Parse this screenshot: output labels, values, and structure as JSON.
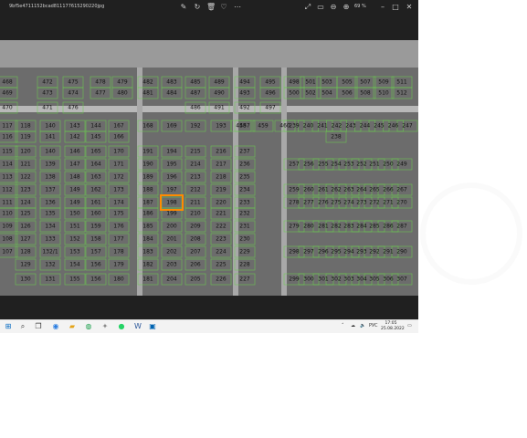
{
  "titlebar": {
    "filename": "9bf5e4711152bcad811177615290220jpg",
    "zoom": "69 %"
  },
  "map": {
    "highlighted_lot": "198",
    "highlight_color": "#ff8a00",
    "line_color": "#6bd04f",
    "lots": [
      {
        "n": "468",
        "c": 0,
        "r": 0
      },
      {
        "n": "472",
        "c": 1,
        "r": 0
      },
      {
        "n": "475",
        "c": 2,
        "r": 0
      },
      {
        "n": "478",
        "c": 3,
        "r": 0
      },
      {
        "n": "479",
        "c": 4,
        "r": 0
      },
      {
        "n": "482",
        "c": 5,
        "r": 0
      },
      {
        "n": "483",
        "c": 6,
        "r": 0
      },
      {
        "n": "485",
        "c": 7,
        "r": 0
      },
      {
        "n": "489",
        "c": 8,
        "r": 0
      },
      {
        "n": "494",
        "c": 9,
        "r": 0
      },
      {
        "n": "495",
        "c": 10,
        "r": 0
      },
      {
        "n": "498",
        "c": 11,
        "r": 0
      },
      {
        "n": "501",
        "c": 12,
        "r": 0
      },
      {
        "n": "503",
        "c": 13,
        "r": 0
      },
      {
        "n": "505",
        "c": 14,
        "r": 0
      },
      {
        "n": "507",
        "c": 15,
        "r": 0
      },
      {
        "n": "509",
        "c": 16,
        "r": 0
      },
      {
        "n": "511",
        "c": 17,
        "r": 0
      },
      {
        "n": "469",
        "c": 0,
        "r": 1
      },
      {
        "n": "473",
        "c": 1,
        "r": 1
      },
      {
        "n": "474",
        "c": 2,
        "r": 1
      },
      {
        "n": "477",
        "c": 3,
        "r": 1
      },
      {
        "n": "480",
        "c": 4,
        "r": 1
      },
      {
        "n": "481",
        "c": 5,
        "r": 1
      },
      {
        "n": "484",
        "c": 6,
        "r": 1
      },
      {
        "n": "487",
        "c": 7,
        "r": 1
      },
      {
        "n": "490",
        "c": 8,
        "r": 1
      },
      {
        "n": "493",
        "c": 9,
        "r": 1
      },
      {
        "n": "496",
        "c": 10,
        "r": 1
      },
      {
        "n": "500",
        "c": 11,
        "r": 1
      },
      {
        "n": "502",
        "c": 12,
        "r": 1
      },
      {
        "n": "504",
        "c": 13,
        "r": 1
      },
      {
        "n": "506",
        "c": 14,
        "r": 1
      },
      {
        "n": "508",
        "c": 15,
        "r": 1
      },
      {
        "n": "510",
        "c": 16,
        "r": 1
      },
      {
        "n": "512",
        "c": 17,
        "r": 1
      },
      {
        "n": "470",
        "c": 0,
        "r": 2
      },
      {
        "n": "471",
        "c": 1,
        "r": 2
      },
      {
        "n": "476",
        "c": 2,
        "r": 2
      },
      {
        "n": "486",
        "c": 7,
        "r": 2
      },
      {
        "n": "491",
        "c": 8,
        "r": 2
      },
      {
        "n": "492",
        "c": 9,
        "r": 2
      },
      {
        "n": "497",
        "c": 10,
        "r": 2
      },
      {
        "n": "117",
        "c": 0,
        "r": 3
      },
      {
        "n": "118",
        "c": 1,
        "r": 3
      },
      {
        "n": "140",
        "c": 2,
        "r": 3
      },
      {
        "n": "143",
        "c": 3,
        "r": 3
      },
      {
        "n": "144",
        "c": 4,
        "r": 3
      },
      {
        "n": "167",
        "c": 5,
        "r": 3
      },
      {
        "n": "168",
        "c": 6,
        "r": 3
      },
      {
        "n": "169",
        "c": 7,
        "r": 3
      },
      {
        "n": "192",
        "c": 8,
        "r": 3
      },
      {
        "n": "193",
        "c": 9,
        "r": 3
      },
      {
        "n": "457",
        "c": 10,
        "r": 3
      },
      {
        "n": "458",
        "c": 11,
        "r": 3
      },
      {
        "n": "459",
        "c": 12,
        "r": 3
      },
      {
        "n": "460",
        "c": 13,
        "r": 3
      },
      {
        "n": "239",
        "c": 14,
        "r": 3
      },
      {
        "n": "240",
        "c": 15,
        "r": 3
      },
      {
        "n": "241",
        "c": 16,
        "r": 3
      },
      {
        "n": "242",
        "c": 17,
        "r": 3
      },
      {
        "n": "243",
        "c": 18,
        "r": 3
      },
      {
        "n": "244",
        "c": 19,
        "r": 3
      },
      {
        "n": "245",
        "c": 20,
        "r": 3
      },
      {
        "n": "246",
        "c": 21,
        "r": 3
      },
      {
        "n": "247",
        "c": 22,
        "r": 3
      },
      {
        "n": "116",
        "c": 0,
        "r": 4
      },
      {
        "n": "119",
        "c": 1,
        "r": 4
      },
      {
        "n": "141",
        "c": 2,
        "r": 4
      },
      {
        "n": "142",
        "c": 3,
        "r": 4
      },
      {
        "n": "145",
        "c": 4,
        "r": 4
      },
      {
        "n": "166",
        "c": 5,
        "r": 4
      },
      {
        "n": "238",
        "c": 14,
        "r": 4
      },
      {
        "n": "115",
        "c": 0,
        "r": 5
      },
      {
        "n": "120",
        "c": 1,
        "r": 5
      },
      {
        "n": "140",
        "c": 2,
        "r": 5
      },
      {
        "n": "146",
        "c": 3,
        "r": 5
      },
      {
        "n": "165",
        "c": 4,
        "r": 5
      },
      {
        "n": "170",
        "c": 5,
        "r": 5
      },
      {
        "n": "191",
        "c": 6,
        "r": 5
      },
      {
        "n": "194",
        "c": 7,
        "r": 5
      },
      {
        "n": "215",
        "c": 8,
        "r": 5
      },
      {
        "n": "216",
        "c": 9,
        "r": 5
      },
      {
        "n": "237",
        "c": 10,
        "r": 5
      },
      {
        "n": "114",
        "c": 0,
        "r": 6
      },
      {
        "n": "121",
        "c": 1,
        "r": 6
      },
      {
        "n": "139",
        "c": 2,
        "r": 6
      },
      {
        "n": "147",
        "c": 3,
        "r": 6
      },
      {
        "n": "164",
        "c": 4,
        "r": 6
      },
      {
        "n": "171",
        "c": 5,
        "r": 6
      },
      {
        "n": "190",
        "c": 6,
        "r": 6
      },
      {
        "n": "195",
        "c": 7,
        "r": 6
      },
      {
        "n": "214",
        "c": 8,
        "r": 6
      },
      {
        "n": "217",
        "c": 9,
        "r": 6
      },
      {
        "n": "236",
        "c": 10,
        "r": 6
      },
      {
        "n": "257",
        "c": 11,
        "r": 6
      },
      {
        "n": "256",
        "c": 12,
        "r": 6
      },
      {
        "n": "255",
        "c": 13,
        "r": 6
      },
      {
        "n": "254",
        "c": 14,
        "r": 6
      },
      {
        "n": "253",
        "c": 15,
        "r": 6
      },
      {
        "n": "252",
        "c": 16,
        "r": 6
      },
      {
        "n": "251",
        "c": 17,
        "r": 6
      },
      {
        "n": "250",
        "c": 18,
        "r": 6
      },
      {
        "n": "249",
        "c": 19,
        "r": 6
      },
      {
        "n": "113",
        "c": 0,
        "r": 7
      },
      {
        "n": "122",
        "c": 1,
        "r": 7
      },
      {
        "n": "138",
        "c": 2,
        "r": 7
      },
      {
        "n": "148",
        "c": 3,
        "r": 7
      },
      {
        "n": "163",
        "c": 4,
        "r": 7
      },
      {
        "n": "172",
        "c": 5,
        "r": 7
      },
      {
        "n": "189",
        "c": 6,
        "r": 7
      },
      {
        "n": "196",
        "c": 7,
        "r": 7
      },
      {
        "n": "213",
        "c": 8,
        "r": 7
      },
      {
        "n": "218",
        "c": 9,
        "r": 7
      },
      {
        "n": "235",
        "c": 10,
        "r": 7
      },
      {
        "n": "112",
        "c": 0,
        "r": 8
      },
      {
        "n": "123",
        "c": 1,
        "r": 8
      },
      {
        "n": "137",
        "c": 2,
        "r": 8
      },
      {
        "n": "149",
        "c": 3,
        "r": 8
      },
      {
        "n": "162",
        "c": 4,
        "r": 8
      },
      {
        "n": "173",
        "c": 5,
        "r": 8
      },
      {
        "n": "188",
        "c": 6,
        "r": 8
      },
      {
        "n": "197",
        "c": 7,
        "r": 8
      },
      {
        "n": "212",
        "c": 8,
        "r": 8
      },
      {
        "n": "219",
        "c": 9,
        "r": 8
      },
      {
        "n": "234",
        "c": 10,
        "r": 8
      },
      {
        "n": "259",
        "c": 11,
        "r": 8
      },
      {
        "n": "260",
        "c": 12,
        "r": 8
      },
      {
        "n": "261",
        "c": 13,
        "r": 8
      },
      {
        "n": "262",
        "c": 14,
        "r": 8
      },
      {
        "n": "263",
        "c": 15,
        "r": 8
      },
      {
        "n": "264",
        "c": 16,
        "r": 8
      },
      {
        "n": "265",
        "c": 17,
        "r": 8
      },
      {
        "n": "266",
        "c": 18,
        "r": 8
      },
      {
        "n": "267",
        "c": 19,
        "r": 8
      },
      {
        "n": "111",
        "c": 0,
        "r": 9
      },
      {
        "n": "124",
        "c": 1,
        "r": 9
      },
      {
        "n": "136",
        "c": 2,
        "r": 9
      },
      {
        "n": "149",
        "c": 3,
        "r": 9
      },
      {
        "n": "161",
        "c": 4,
        "r": 9
      },
      {
        "n": "174",
        "c": 5,
        "r": 9
      },
      {
        "n": "187",
        "c": 6,
        "r": 9
      },
      {
        "n": "198",
        "c": 7,
        "r": 9
      },
      {
        "n": "211",
        "c": 8,
        "r": 9
      },
      {
        "n": "220",
        "c": 9,
        "r": 9
      },
      {
        "n": "233",
        "c": 10,
        "r": 9
      },
      {
        "n": "278",
        "c": 11,
        "r": 9
      },
      {
        "n": "277",
        "c": 12,
        "r": 9
      },
      {
        "n": "276",
        "c": 13,
        "r": 9
      },
      {
        "n": "275",
        "c": 14,
        "r": 9
      },
      {
        "n": "274",
        "c": 15,
        "r": 9
      },
      {
        "n": "273",
        "c": 16,
        "r": 9
      },
      {
        "n": "272",
        "c": 17,
        "r": 9
      },
      {
        "n": "271",
        "c": 18,
        "r": 9
      },
      {
        "n": "270",
        "c": 19,
        "r": 9
      },
      {
        "n": "110",
        "c": 0,
        "r": 10
      },
      {
        "n": "125",
        "c": 1,
        "r": 10
      },
      {
        "n": "135",
        "c": 2,
        "r": 10
      },
      {
        "n": "150",
        "c": 3,
        "r": 10
      },
      {
        "n": "160",
        "c": 4,
        "r": 10
      },
      {
        "n": "175",
        "c": 5,
        "r": 10
      },
      {
        "n": "186",
        "c": 6,
        "r": 10
      },
      {
        "n": "199",
        "c": 7,
        "r": 10
      },
      {
        "n": "210",
        "c": 8,
        "r": 10
      },
      {
        "n": "221",
        "c": 9,
        "r": 10
      },
      {
        "n": "232",
        "c": 10,
        "r": 10
      },
      {
        "n": "109",
        "c": 0,
        "r": 11
      },
      {
        "n": "126",
        "c": 1,
        "r": 11
      },
      {
        "n": "134",
        "c": 2,
        "r": 11
      },
      {
        "n": "151",
        "c": 3,
        "r": 11
      },
      {
        "n": "159",
        "c": 4,
        "r": 11
      },
      {
        "n": "176",
        "c": 5,
        "r": 11
      },
      {
        "n": "185",
        "c": 6,
        "r": 11
      },
      {
        "n": "200",
        "c": 7,
        "r": 11
      },
      {
        "n": "209",
        "c": 8,
        "r": 11
      },
      {
        "n": "222",
        "c": 9,
        "r": 11
      },
      {
        "n": "231",
        "c": 10,
        "r": 11
      },
      {
        "n": "279",
        "c": 11,
        "r": 11
      },
      {
        "n": "280",
        "c": 12,
        "r": 11
      },
      {
        "n": "281",
        "c": 13,
        "r": 11
      },
      {
        "n": "282",
        "c": 14,
        "r": 11
      },
      {
        "n": "283",
        "c": 15,
        "r": 11
      },
      {
        "n": "284",
        "c": 16,
        "r": 11
      },
      {
        "n": "285",
        "c": 17,
        "r": 11
      },
      {
        "n": "286",
        "c": 18,
        "r": 11
      },
      {
        "n": "287",
        "c": 19,
        "r": 11
      },
      {
        "n": "108",
        "c": 0,
        "r": 12
      },
      {
        "n": "127",
        "c": 1,
        "r": 12
      },
      {
        "n": "133",
        "c": 2,
        "r": 12
      },
      {
        "n": "152",
        "c": 3,
        "r": 12
      },
      {
        "n": "158",
        "c": 4,
        "r": 12
      },
      {
        "n": "177",
        "c": 5,
        "r": 12
      },
      {
        "n": "184",
        "c": 6,
        "r": 12
      },
      {
        "n": "201",
        "c": 7,
        "r": 12
      },
      {
        "n": "208",
        "c": 8,
        "r": 12
      },
      {
        "n": "223",
        "c": 9,
        "r": 12
      },
      {
        "n": "230",
        "c": 10,
        "r": 12
      },
      {
        "n": "107",
        "c": 0,
        "r": 13
      },
      {
        "n": "128",
        "c": 1,
        "r": 13
      },
      {
        "n": "132/1",
        "c": 2,
        "r": 13
      },
      {
        "n": "153",
        "c": 3,
        "r": 13
      },
      {
        "n": "157",
        "c": 4,
        "r": 13
      },
      {
        "n": "178",
        "c": 5,
        "r": 13
      },
      {
        "n": "183",
        "c": 6,
        "r": 13
      },
      {
        "n": "202",
        "c": 7,
        "r": 13
      },
      {
        "n": "207",
        "c": 8,
        "r": 13
      },
      {
        "n": "224",
        "c": 9,
        "r": 13
      },
      {
        "n": "229",
        "c": 10,
        "r": 13
      },
      {
        "n": "298",
        "c": 11,
        "r": 13
      },
      {
        "n": "297",
        "c": 12,
        "r": 13
      },
      {
        "n": "296",
        "c": 13,
        "r": 13
      },
      {
        "n": "295",
        "c": 14,
        "r": 13
      },
      {
        "n": "294",
        "c": 15,
        "r": 13
      },
      {
        "n": "293",
        "c": 16,
        "r": 13
      },
      {
        "n": "292",
        "c": 17,
        "r": 13
      },
      {
        "n": "291",
        "c": 18,
        "r": 13
      },
      {
        "n": "290",
        "c": 19,
        "r": 13
      },
      {
        "n": "129",
        "c": 1,
        "r": 14
      },
      {
        "n": "132",
        "c": 2,
        "r": 14
      },
      {
        "n": "154",
        "c": 3,
        "r": 14
      },
      {
        "n": "156",
        "c": 4,
        "r": 14
      },
      {
        "n": "179",
        "c": 5,
        "r": 14
      },
      {
        "n": "182",
        "c": 6,
        "r": 14
      },
      {
        "n": "203",
        "c": 7,
        "r": 14
      },
      {
        "n": "206",
        "c": 8,
        "r": 14
      },
      {
        "n": "225",
        "c": 9,
        "r": 14
      },
      {
        "n": "228",
        "c": 10,
        "r": 14
      },
      {
        "n": "130",
        "c": 1,
        "r": 15
      },
      {
        "n": "131",
        "c": 2,
        "r": 15
      },
      {
        "n": "155",
        "c": 3,
        "r": 15
      },
      {
        "n": "156",
        "c": 4,
        "r": 15
      },
      {
        "n": "180",
        "c": 5,
        "r": 15
      },
      {
        "n": "181",
        "c": 6,
        "r": 15
      },
      {
        "n": "204",
        "c": 7,
        "r": 15
      },
      {
        "n": "205",
        "c": 8,
        "r": 15
      },
      {
        "n": "226",
        "c": 9,
        "r": 15
      },
      {
        "n": "227",
        "c": 10,
        "r": 15
      },
      {
        "n": "299",
        "c": 11,
        "r": 15
      },
      {
        "n": "300",
        "c": 12,
        "r": 15
      },
      {
        "n": "301",
        "c": 13,
        "r": 15
      },
      {
        "n": "302",
        "c": 14,
        "r": 15
      },
      {
        "n": "303",
        "c": 15,
        "r": 15
      },
      {
        "n": "304",
        "c": 16,
        "r": 15
      },
      {
        "n": "305",
        "c": 17,
        "r": 15
      },
      {
        "n": "306",
        "c": 18,
        "r": 15
      },
      {
        "n": "307",
        "c": 19,
        "r": 15
      }
    ]
  },
  "taskbar": {
    "icons": [
      "start-icon",
      "search-icon",
      "task-view-icon",
      "edge-icon",
      "file-explorer-icon",
      "chrome-icon",
      "pinned-app-icon",
      "whatsapp-icon",
      "word-icon",
      "photos-icon"
    ],
    "tray_lang": "РУС",
    "time": "17:05",
    "date": "25.08.2022"
  }
}
